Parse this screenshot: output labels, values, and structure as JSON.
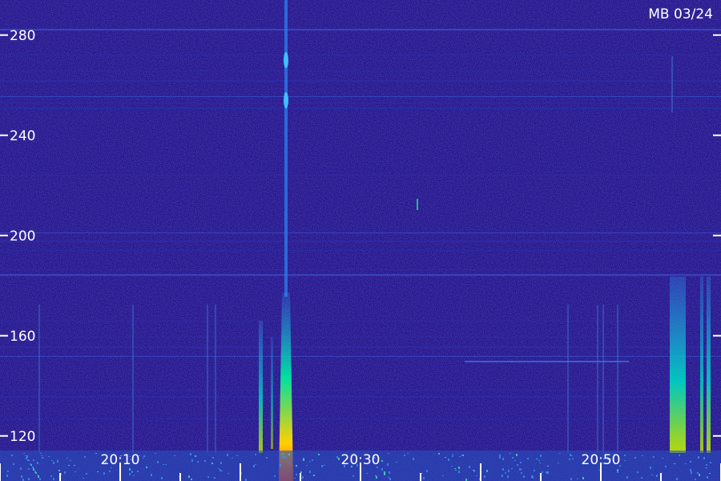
{
  "chart_data": {
    "type": "heatmap",
    "title": "MB 03/24",
    "xlabel": "",
    "ylabel": "",
    "y_ticks": [
      120,
      160,
      200,
      240,
      280
    ],
    "x_ticks": [
      "20:10",
      "20:30",
      "20:50"
    ],
    "ylim": [
      102,
      294
    ],
    "grid": false,
    "colors": {
      "background": "#1f0f7a",
      "noise_low": "#10085a",
      "noise_high": "#3a3ad0",
      "signal_mid": "#2aa0ff",
      "signal_high": "#00e0a0",
      "peak": "#ffd000",
      "max": "#ff2000",
      "axis_text": "#ffffff"
    }
  }
}
